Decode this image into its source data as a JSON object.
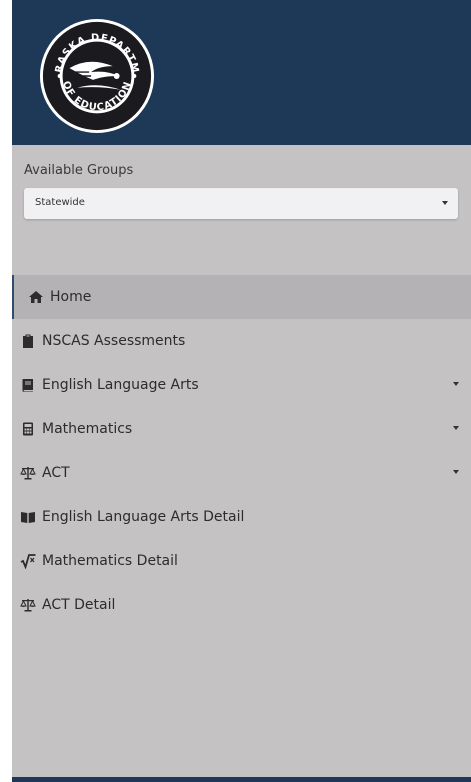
{
  "logo": {
    "text_top": "NEBRASKA DEPARTMENT",
    "text_bottom": "OF EDUCATION"
  },
  "groups": {
    "label": "Available Groups",
    "selected": "Statewide"
  },
  "nav": {
    "items": [
      {
        "label": "Home",
        "icon": "home-icon",
        "active": true,
        "has_dropdown": false
      },
      {
        "label": "NSCAS Assessments",
        "icon": "clipboard-icon",
        "active": false,
        "has_dropdown": false
      },
      {
        "label": "English Language Arts",
        "icon": "book-icon",
        "active": false,
        "has_dropdown": true
      },
      {
        "label": "Mathematics",
        "icon": "calculator-icon",
        "active": false,
        "has_dropdown": true
      },
      {
        "label": "ACT",
        "icon": "scale-icon",
        "active": false,
        "has_dropdown": true
      },
      {
        "label": "English Language Arts Detail",
        "icon": "open-book-icon",
        "active": false,
        "has_dropdown": false
      },
      {
        "label": "Mathematics Detail",
        "icon": "square-root-icon",
        "active": false,
        "has_dropdown": false
      },
      {
        "label": "ACT Detail",
        "icon": "scale-icon",
        "active": false,
        "has_dropdown": false
      }
    ]
  },
  "colors": {
    "header": "#1d3957",
    "sidebar": "#c4c2c3",
    "active_item": "#b4b2b4"
  }
}
